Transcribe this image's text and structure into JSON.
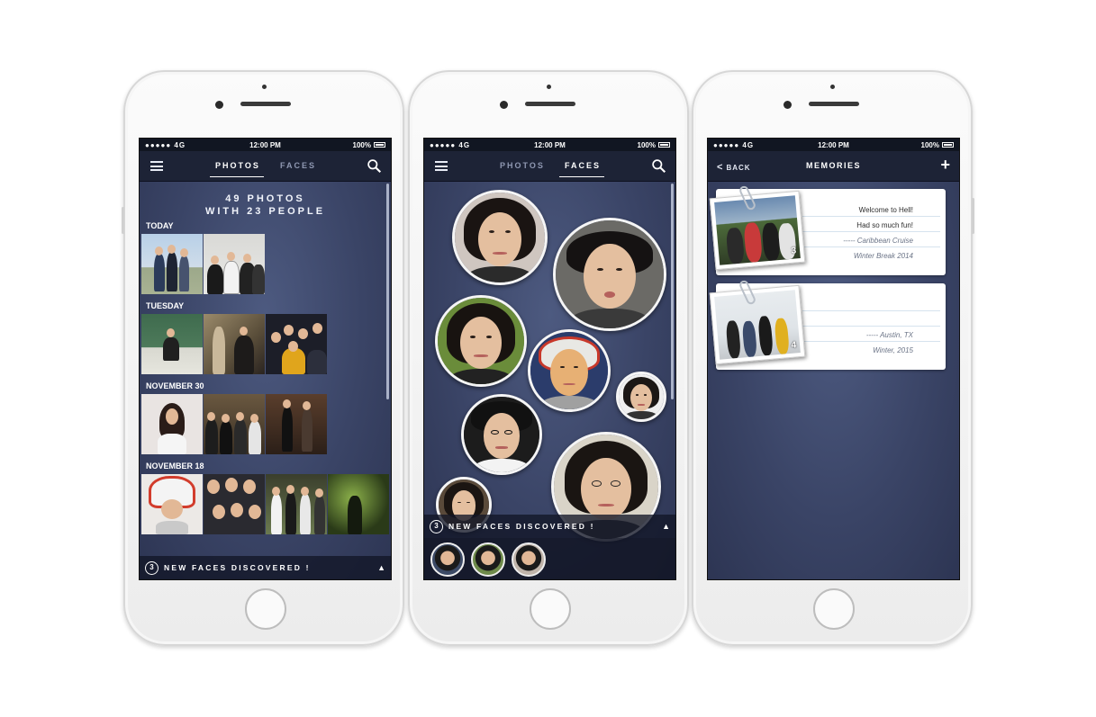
{
  "status_bar": {
    "signal": "●●●●● 4G",
    "time": "12:00 PM",
    "battery": "100%"
  },
  "screen_photos": {
    "tabs": [
      "PHOTOS",
      "FACES"
    ],
    "active_tab": "PHOTOS",
    "summary_line1": "49  PHOTOS",
    "summary_line2": "WITH 23 PEOPLE",
    "sections": [
      "TODAY",
      "TUESDAY",
      "NOVEMBER 30",
      "NOVEMBER 18"
    ],
    "banner_count": "3",
    "banner_text": "NEW FACES DISCOVERED !",
    "banner_caret": "▲"
  },
  "screen_faces": {
    "tabs": [
      "PHOTOS",
      "FACES"
    ],
    "active_tab": "FACES",
    "banner_count": "3",
    "banner_text": "NEW FACES DISCOVERED !",
    "banner_caret": "▲"
  },
  "screen_memories": {
    "back_label": "BACK",
    "title": "MEMORIES",
    "add_label": "+",
    "cards": [
      {
        "photo_count": "3",
        "lines": [
          "Welcome to Hell!",
          "Had so much fun!",
          "----- Caribbean Cruise",
          "Winter Break 2014"
        ]
      },
      {
        "photo_count": "4",
        "lines": [
          "",
          "",
          "----- Austin, TX",
          "Winter, 2015"
        ]
      }
    ]
  },
  "icons": {
    "menu": "menu-icon",
    "search": "search-icon",
    "back": "chevron-left-icon",
    "add": "plus-icon"
  },
  "colors": {
    "screen_bg": "#3a4466",
    "navbar": "#1d2336",
    "accent": "#ffffff"
  }
}
